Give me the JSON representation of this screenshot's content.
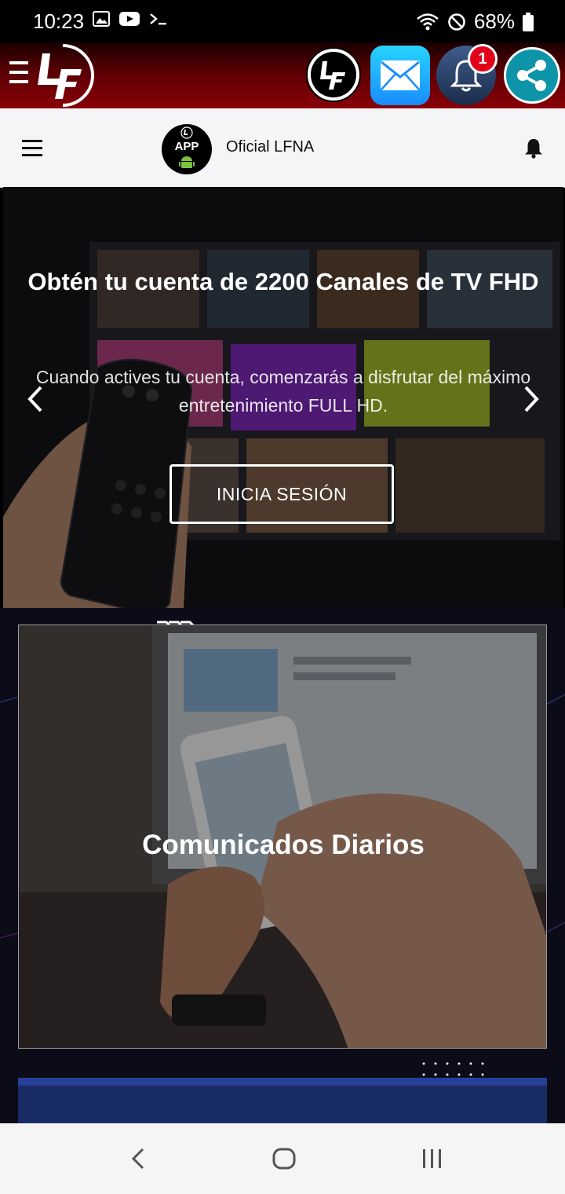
{
  "status_bar": {
    "time": "10:23",
    "battery": "68%"
  },
  "web_header": {
    "logo_text": "APP",
    "site_title": "Oficial LFNA"
  },
  "toolbar": {
    "notification_count": "1"
  },
  "hero": {
    "title": "Obtén tu cuenta de 2200 Canales de TV FHD",
    "description": "Cuando actives tu cuenta, comenzarás a disfrutar del máximo entretenimiento FULL HD.",
    "button_label": "INICIA SESIÓN"
  },
  "card": {
    "title": "Comunicados Diarios"
  },
  "colors": {
    "toolbar_red": "#8a0008",
    "badge_red": "#e3001b",
    "share_teal": "#0e94a8",
    "mail_blue": "#1a8cff"
  }
}
